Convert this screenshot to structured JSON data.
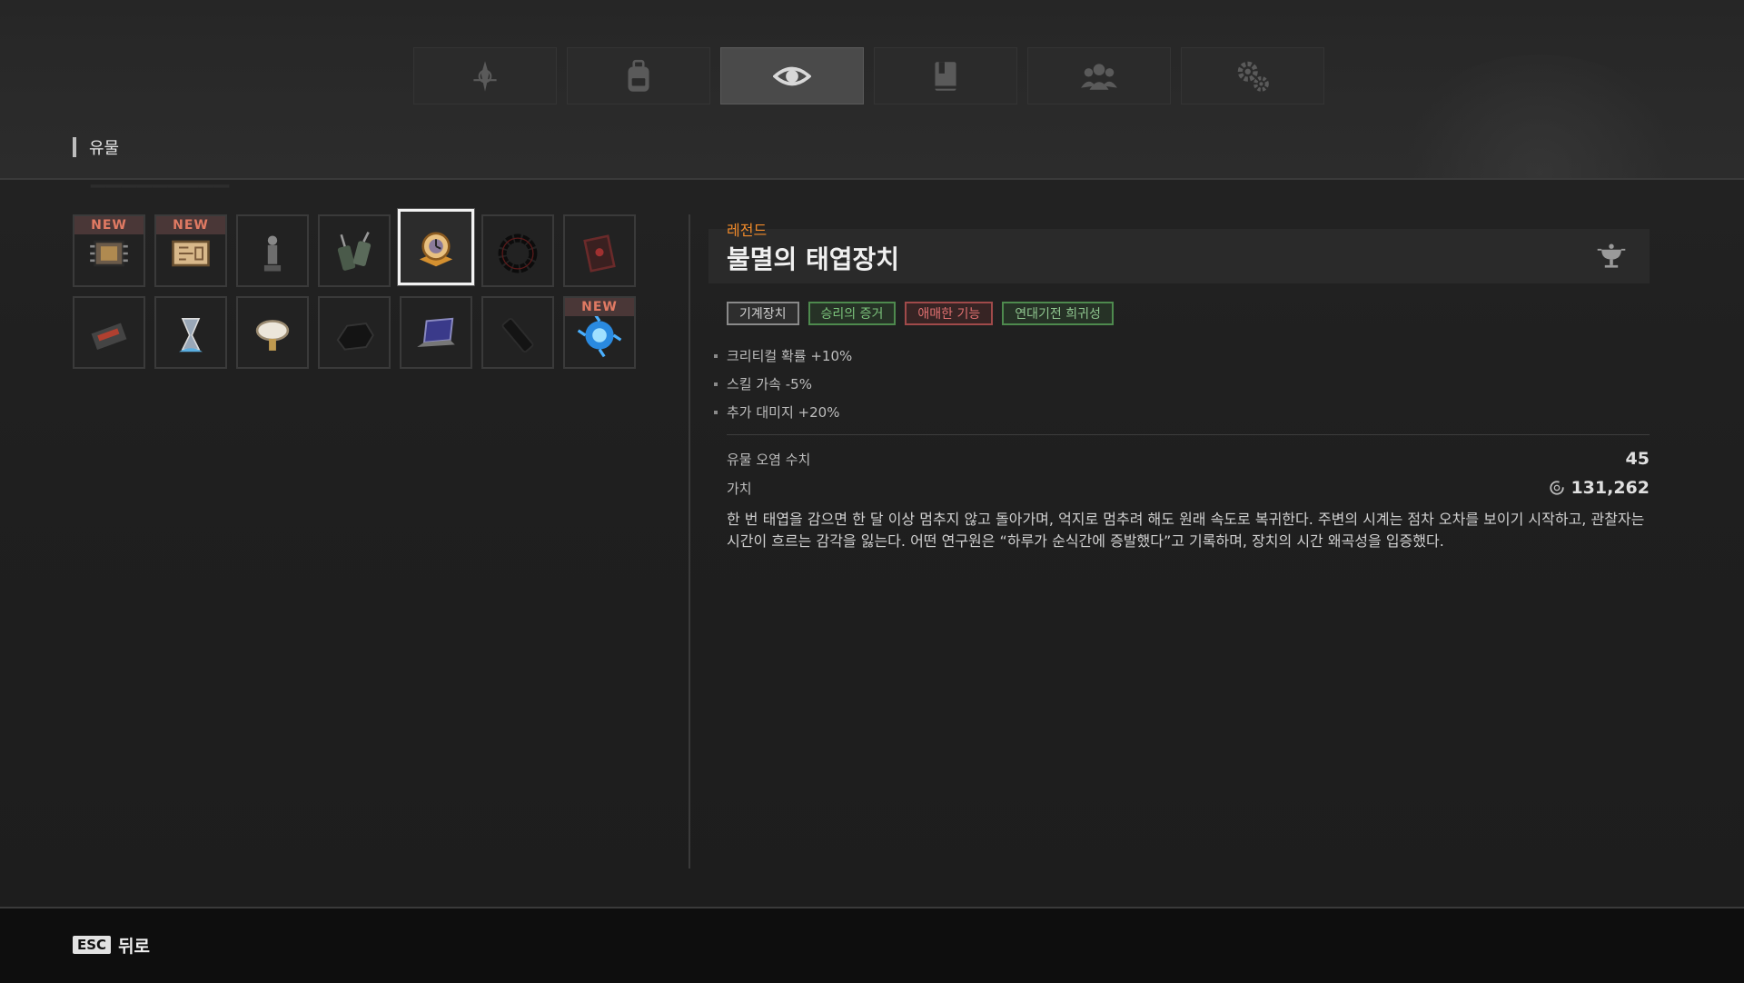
{
  "tabs": [
    {
      "icon": "compass-icon"
    },
    {
      "icon": "backpack-icon"
    },
    {
      "icon": "eye-icon",
      "active": true
    },
    {
      "icon": "book-icon"
    },
    {
      "icon": "group-icon"
    },
    {
      "icon": "gears-icon"
    }
  ],
  "section": {
    "label": "유물"
  },
  "items": [
    {
      "icon": "chip-icon",
      "new": true
    },
    {
      "icon": "map-icon",
      "new": true
    },
    {
      "icon": "statue-icon",
      "new": false
    },
    {
      "icon": "walkie-talkie-icon",
      "new": false
    },
    {
      "icon": "clock-device-icon",
      "new": false,
      "selected": true
    },
    {
      "icon": "black-ring-icon",
      "new": false
    },
    {
      "icon": "red-book-icon",
      "new": false
    },
    {
      "icon": "cassette-icon",
      "new": false
    },
    {
      "icon": "hourglass-icon",
      "new": false
    },
    {
      "icon": "magnifier-icon",
      "new": false
    },
    {
      "icon": "dark-rock-icon",
      "new": false
    },
    {
      "icon": "laptop-icon",
      "new": false
    },
    {
      "icon": "phone-icon",
      "new": false
    },
    {
      "icon": "blue-orb-icon",
      "new": true
    }
  ],
  "new_badge": "NEW",
  "detail": {
    "rarity": "레전드",
    "title": "불멸의 태엽장치",
    "tags": [
      "기계장치",
      "승리의 증거",
      "애매한 기능",
      "연대기전 희귀성"
    ],
    "stats": [
      "크리티컬 확률 +10%",
      "스킬 가속 -5%",
      "추가 대미지 +20%"
    ],
    "contamination_label": "유물 오염 수치",
    "contamination_value": "45",
    "value_label": "가치",
    "value_amount": "131,262",
    "description": "한 번 태엽을 감으면 한 달 이상 멈추지 않고 돌아가며, 억지로 멈추려 해도 원래 속도로 복귀한다. 주변의 시계는 점차 오차를 보이기 시작하고, 관찰자는 시간이 흐르는 감각을 잃는다. 어떤 연구원은 “하루가 순식간에 증발했다”고 기록하며, 장치의 시간 왜곡성을 입증했다."
  },
  "footer": {
    "esc_key": "ESC",
    "back_label": "뒤로"
  },
  "colors": {
    "rarity": "#f08a2a",
    "new_badge": "#e07a63",
    "tag_green": "#7cc47c",
    "tag_red": "#e07070"
  }
}
